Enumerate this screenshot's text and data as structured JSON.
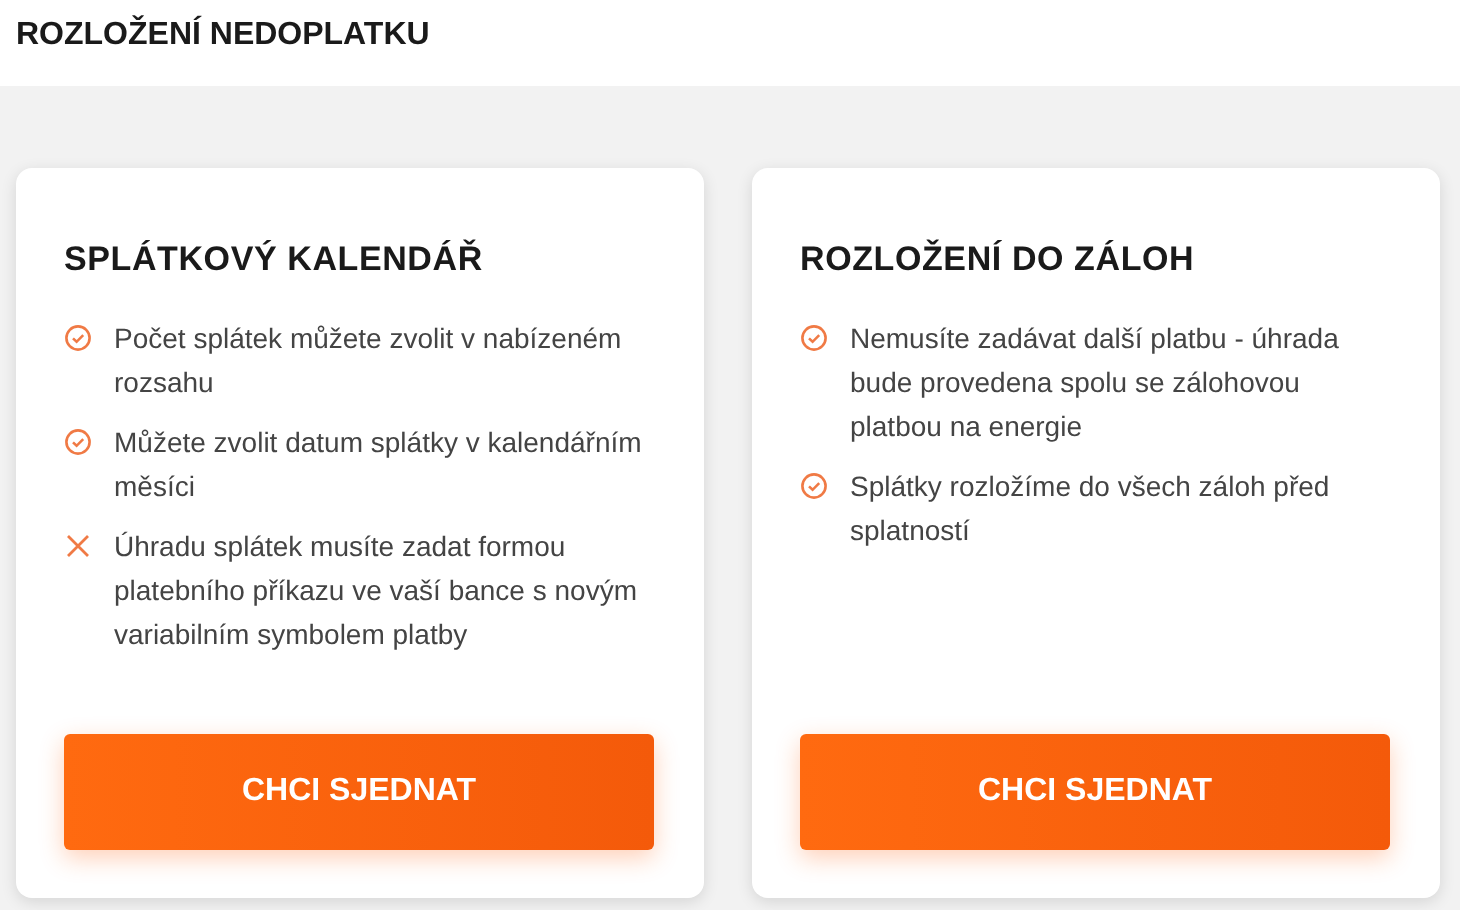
{
  "header": {
    "title": "ROZLOŽENÍ NEDOPLATKU"
  },
  "cards": [
    {
      "title": "SPLÁTKOVÝ KALENDÁŘ",
      "items": [
        {
          "kind": "pro",
          "text": "Počet splátek můžete zvolit v nabízeném rozsahu"
        },
        {
          "kind": "pro",
          "text": "Můžete zvolit datum splátky v kalendářním měsíci"
        },
        {
          "kind": "con",
          "text": "Úhradu splátek musíte zadat formou platebního příkazu ve vaší bance s novým variabilním symbolem platby"
        }
      ],
      "button": "CHCI SJEDNAT"
    },
    {
      "title": "ROZLOŽENÍ DO ZÁLOH",
      "items": [
        {
          "kind": "pro",
          "text": "Nemusíte zadávat další platbu - úhrada bude provedena spolu se zálohovou platbou na energie"
        },
        {
          "kind": "pro",
          "text": "Splátky rozložíme do všech záloh před splatností"
        }
      ],
      "button": "CHCI SJEDNAT"
    }
  ]
}
